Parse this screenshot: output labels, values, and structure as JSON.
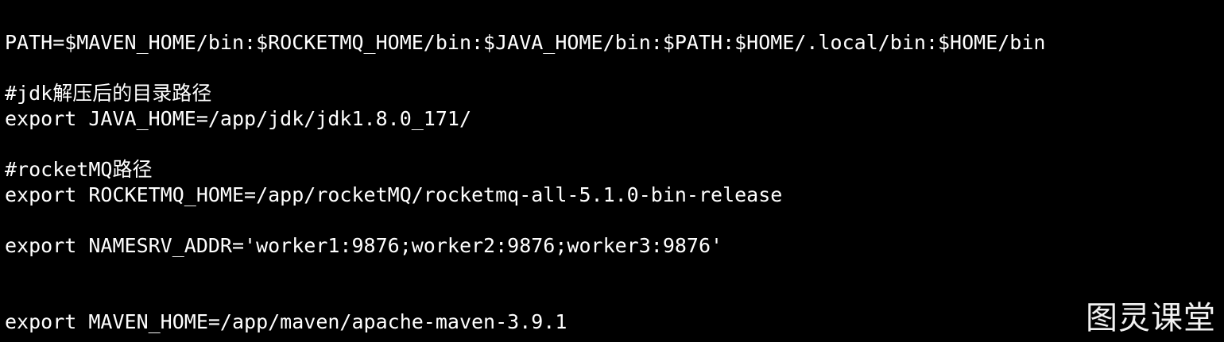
{
  "terminal": {
    "background": "#000000",
    "foreground": "#ffffff",
    "lines": [
      "PATH=$MAVEN_HOME/bin:$ROCKETMQ_HOME/bin:$JAVA_HOME/bin:$PATH:$HOME/.local/bin:$HOME/bin",
      "#jdk解压后的目录路径",
      "export JAVA_HOME=/app/jdk/jdk1.8.0_171/",
      "#rocketMQ路径",
      "export ROCKETMQ_HOME=/app/rocketMQ/rocketmq-all-5.1.0-bin-release",
      "export NAMESRV_ADDR='worker1:9876;worker2:9876;worker3:9876'",
      "export MAVEN_HOME=/app/maven/apache-maven-3.9.1"
    ]
  },
  "watermark": {
    "text": "图灵课堂"
  }
}
